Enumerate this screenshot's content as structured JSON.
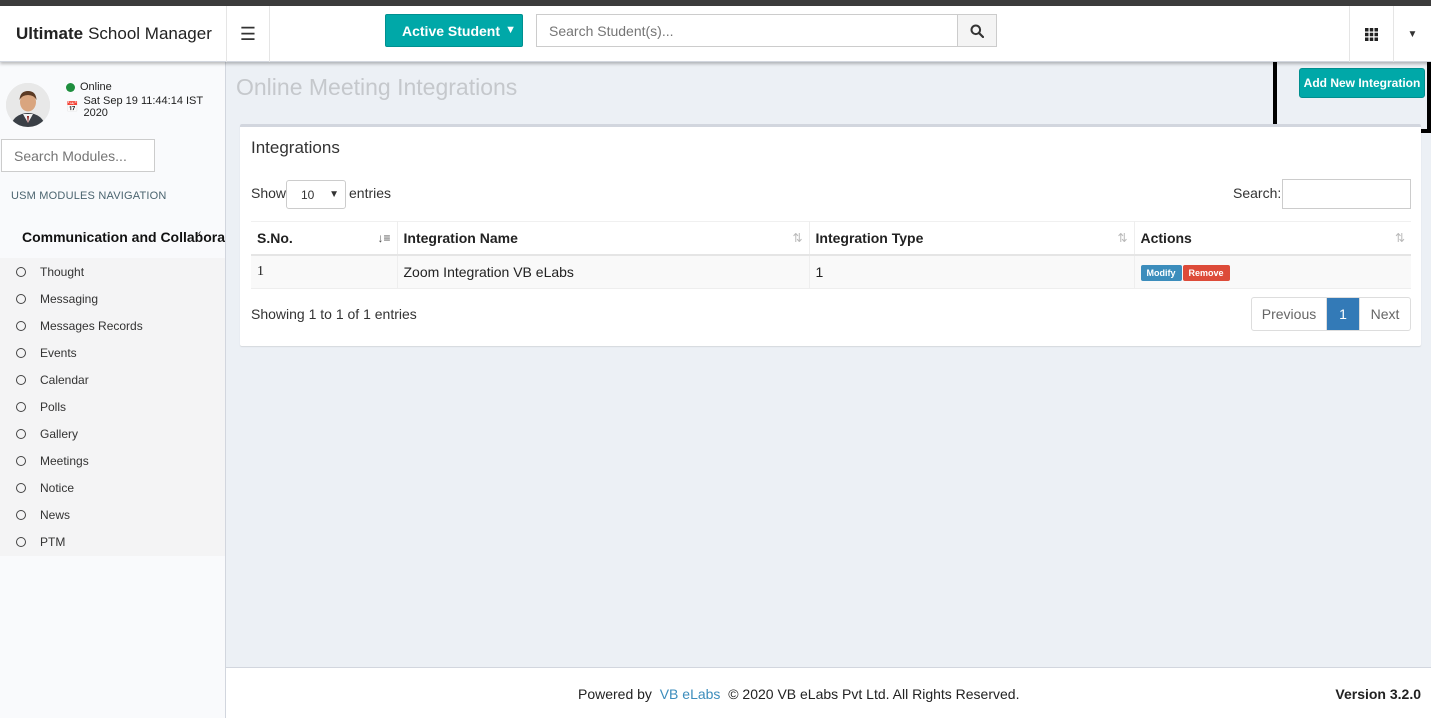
{
  "app": {
    "title_bold": "Ultimate",
    "title_rest": "School Manager"
  },
  "header": {
    "student_filter": "Active Student",
    "search_placeholder": "Search Student(s)..."
  },
  "sidebar": {
    "status": "Online",
    "datetime": "Sat Sep 19 11:44:14 IST 2020",
    "search_placeholder": "Search Modules...",
    "nav_header": "USM MODULES NAVIGATION",
    "group_label": "Communication and Collaboration",
    "items": [
      {
        "label": "Thought"
      },
      {
        "label": "Messaging"
      },
      {
        "label": "Messages Records"
      },
      {
        "label": "Events"
      },
      {
        "label": "Calendar"
      },
      {
        "label": "Polls"
      },
      {
        "label": "Gallery"
      },
      {
        "label": "Meetings"
      },
      {
        "label": "Notice"
      },
      {
        "label": "News"
      },
      {
        "label": "PTM"
      }
    ]
  },
  "page": {
    "title": "Online Meeting Integrations",
    "add_button": "Add New Integration"
  },
  "box": {
    "title": "Integrations",
    "show_label": "Show",
    "page_length": "10",
    "entries_label": "entries",
    "search_label": "Search:",
    "columns": [
      "S.No.",
      "Integration Name",
      "Integration Type",
      "Actions"
    ],
    "rows": [
      {
        "sno": "1",
        "name": "Zoom Integration VB eLabs",
        "type": "1",
        "modify": "Modify",
        "remove": "Remove"
      }
    ],
    "info": "Showing 1 to 1 of 1 entries",
    "pager": {
      "previous": "Previous",
      "current": "1",
      "next": "Next"
    }
  },
  "footer": {
    "powered_by": "Powered by",
    "company_link": "VB eLabs",
    "copyright": "© 2020 VB eLabs Pvt Ltd. All Rights Reserved.",
    "version": "Version 3.2.0"
  },
  "colors": {
    "accent": "#00a8a8",
    "primary": "#3c8dbc",
    "danger": "#dd4b39",
    "online": "#1e8e3e"
  }
}
